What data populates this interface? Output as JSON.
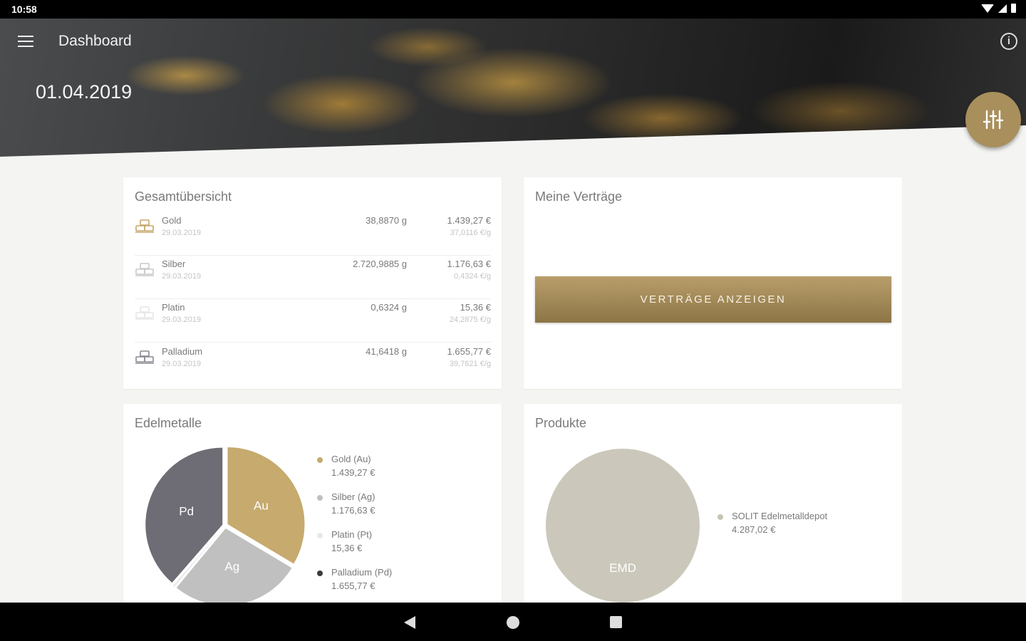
{
  "status_bar": {
    "time": "10:58"
  },
  "header": {
    "title": "Dashboard",
    "date": "01.04.2019"
  },
  "overview": {
    "title": "Gesamtübersicht",
    "rows": [
      {
        "name": "Gold",
        "date": "29.03.2019",
        "grams": "38,8870 g",
        "eur": "1.439,27 €",
        "per_gram": "37,0116 €/g",
        "color": "#c5a66a"
      },
      {
        "name": "Silber",
        "date": "29.03.2019",
        "grams": "2.720,9885 g",
        "eur": "1.176,63 €",
        "per_gram": "0,4324 €/g",
        "color": "#c8c8c8"
      },
      {
        "name": "Platin",
        "date": "29.03.2019",
        "grams": "0,6324 g",
        "eur": "15,36 €",
        "per_gram": "24,2875 €/g",
        "color": "#e6e6e6"
      },
      {
        "name": "Palladium",
        "date": "29.03.2019",
        "grams": "41,6418 g",
        "eur": "1.655,77 €",
        "per_gram": "39,7621 €/g",
        "color": "#8a8890"
      }
    ]
  },
  "contracts": {
    "title": "Meine Verträge",
    "button_label": "VERTRÄGE ANZEIGEN"
  },
  "edelmetalle": {
    "title": "Edelmetalle",
    "legend": [
      {
        "name": "Gold (Au)",
        "value": "1.439,27 €",
        "color": "#c6aa6e"
      },
      {
        "name": "Silber (Ag)",
        "value": "1.176,63 €",
        "color": "#c0c0c0"
      },
      {
        "name": "Platin (Pt)",
        "value": "15,36 €",
        "color": "#e8e8e8"
      },
      {
        "name": "Palladium (Pd)",
        "value": "1.655,77 €",
        "color": "#3b3a40"
      }
    ]
  },
  "produkte": {
    "title": "Produkte",
    "legend": [
      {
        "name": "SOLIT Edelmetalldepot",
        "value": "4.287,02 €",
        "color": "#c8c4b4"
      }
    ]
  },
  "chart_data": [
    {
      "type": "pie",
      "categories": [
        "Au",
        "Ag",
        "Pt",
        "Pd"
      ],
      "values": [
        1439.27,
        1176.63,
        15.36,
        1655.77
      ],
      "colors": [
        "#c6aa6e",
        "#c0c0c0",
        "#e8e8e8",
        "#6e6c74"
      ]
    },
    {
      "type": "pie",
      "categories": [
        "EMD"
      ],
      "values": [
        4287.02
      ],
      "colors": [
        "#cbc8bb"
      ]
    }
  ]
}
